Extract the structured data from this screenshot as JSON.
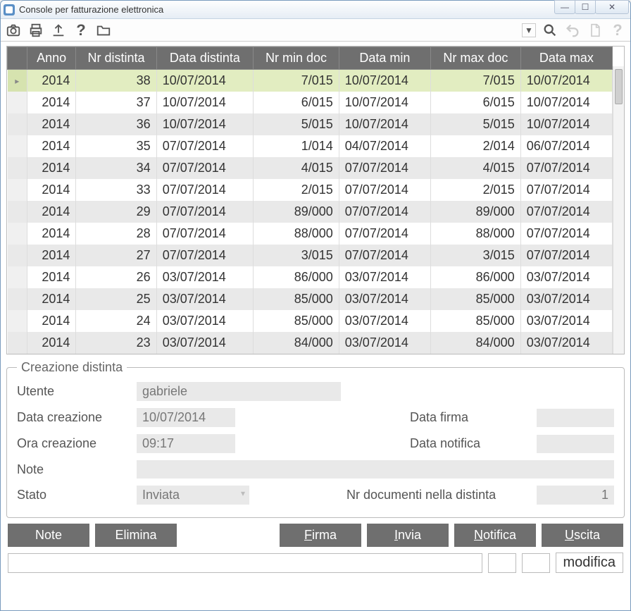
{
  "window": {
    "title": "Console per fatturazione elettronica"
  },
  "win_controls": {
    "min": "—",
    "max": "☐",
    "close": "✕"
  },
  "toolbar_icons": {
    "camera": "camera-icon",
    "print": "print-icon",
    "upload": "upload-icon",
    "help": "?",
    "folder": "folder-icon",
    "drop": "▼",
    "search": "search-icon",
    "undo": "undo-icon",
    "doc": "doc-icon",
    "help2": "?"
  },
  "grid": {
    "headers": [
      "Anno",
      "Nr distinta",
      "Data distinta",
      "Nr min doc",
      "Data min",
      "Nr max doc",
      "Data max"
    ],
    "rows": [
      {
        "sel": true,
        "anno": "2014",
        "nr": "38",
        "data": "10/07/2014",
        "nmin": "7/015",
        "dmin": "10/07/2014",
        "nmax": "7/015",
        "dmax": "10/07/2014"
      },
      {
        "sel": false,
        "anno": "2014",
        "nr": "37",
        "data": "10/07/2014",
        "nmin": "6/015",
        "dmin": "10/07/2014",
        "nmax": "6/015",
        "dmax": "10/07/2014"
      },
      {
        "sel": false,
        "anno": "2014",
        "nr": "36",
        "data": "10/07/2014",
        "nmin": "5/015",
        "dmin": "10/07/2014",
        "nmax": "5/015",
        "dmax": "10/07/2014"
      },
      {
        "sel": false,
        "anno": "2014",
        "nr": "35",
        "data": "07/07/2014",
        "nmin": "1/014",
        "dmin": "04/07/2014",
        "nmax": "2/014",
        "dmax": "06/07/2014"
      },
      {
        "sel": false,
        "anno": "2014",
        "nr": "34",
        "data": "07/07/2014",
        "nmin": "4/015",
        "dmin": "07/07/2014",
        "nmax": "4/015",
        "dmax": "07/07/2014"
      },
      {
        "sel": false,
        "anno": "2014",
        "nr": "33",
        "data": "07/07/2014",
        "nmin": "2/015",
        "dmin": "07/07/2014",
        "nmax": "2/015",
        "dmax": "07/07/2014"
      },
      {
        "sel": false,
        "anno": "2014",
        "nr": "29",
        "data": "07/07/2014",
        "nmin": "89/000",
        "dmin": "07/07/2014",
        "nmax": "89/000",
        "dmax": "07/07/2014"
      },
      {
        "sel": false,
        "anno": "2014",
        "nr": "28",
        "data": "07/07/2014",
        "nmin": "88/000",
        "dmin": "07/07/2014",
        "nmax": "88/000",
        "dmax": "07/07/2014"
      },
      {
        "sel": false,
        "anno": "2014",
        "nr": "27",
        "data": "07/07/2014",
        "nmin": "3/015",
        "dmin": "07/07/2014",
        "nmax": "3/015",
        "dmax": "07/07/2014"
      },
      {
        "sel": false,
        "anno": "2014",
        "nr": "26",
        "data": "03/07/2014",
        "nmin": "86/000",
        "dmin": "03/07/2014",
        "nmax": "86/000",
        "dmax": "03/07/2014"
      },
      {
        "sel": false,
        "anno": "2014",
        "nr": "25",
        "data": "03/07/2014",
        "nmin": "85/000",
        "dmin": "03/07/2014",
        "nmax": "85/000",
        "dmax": "03/07/2014"
      },
      {
        "sel": false,
        "anno": "2014",
        "nr": "24",
        "data": "03/07/2014",
        "nmin": "85/000",
        "dmin": "03/07/2014",
        "nmax": "85/000",
        "dmax": "03/07/2014"
      },
      {
        "sel": false,
        "anno": "2014",
        "nr": "23",
        "data": "03/07/2014",
        "nmin": "84/000",
        "dmin": "03/07/2014",
        "nmax": "84/000",
        "dmax": "03/07/2014"
      }
    ]
  },
  "details": {
    "legend": "Creazione distinta",
    "labels": {
      "utente": "Utente",
      "data_creazione": "Data creazione",
      "ora_creazione": "Ora creazione",
      "note": "Note",
      "stato": "Stato",
      "data_firma": "Data firma",
      "data_notifica": "Data notifica",
      "nr_docs": "Nr documenti nella distinta"
    },
    "values": {
      "utente": "gabriele",
      "data_creazione": "10/07/2014",
      "ora_creazione": "09:17",
      "note": "",
      "stato": "Inviata",
      "data_firma": "",
      "data_notifica": "",
      "nr_docs": "1"
    }
  },
  "buttons": {
    "note": "Note",
    "elimina": "Elimina",
    "firma": "Firma",
    "invia": "Invia",
    "notifica": "Notifica",
    "uscita": "Uscita"
  },
  "status": {
    "modifica_label": "modifica"
  }
}
